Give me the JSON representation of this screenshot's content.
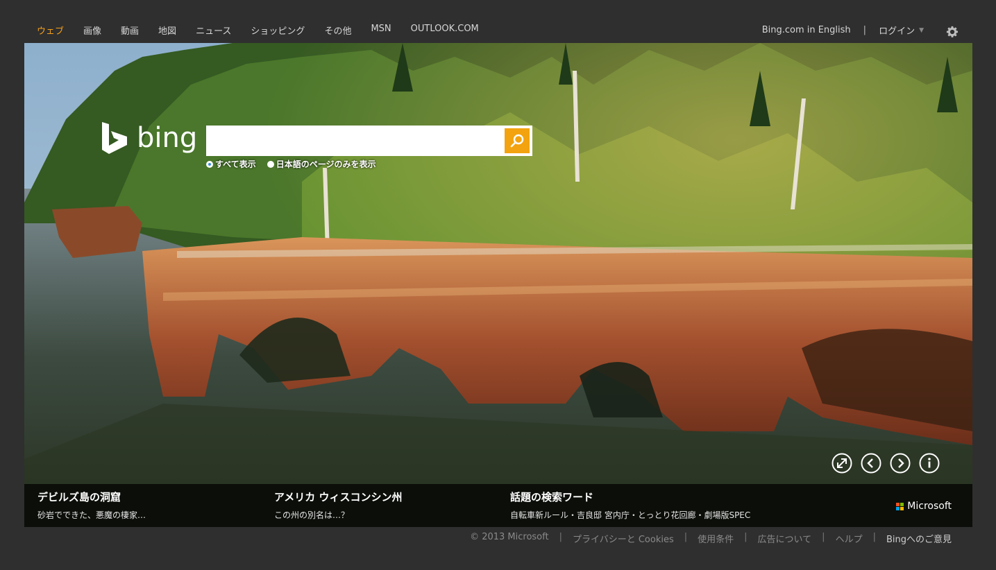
{
  "nav": {
    "items": [
      {
        "label": "ウェブ",
        "active": true
      },
      {
        "label": "画像"
      },
      {
        "label": "動画"
      },
      {
        "label": "地図"
      },
      {
        "label": "ニュース"
      },
      {
        "label": "ショッピング"
      },
      {
        "label": "その他"
      },
      {
        "label": "MSN"
      },
      {
        "label": "OUTLOOK.COM"
      }
    ],
    "english": "Bing.com in English",
    "separator": "|",
    "login": "ログイン",
    "settings_icon": "gear-icon"
  },
  "search": {
    "logo": "bing",
    "value": "",
    "placeholder": "",
    "radio_all": "すべて表示",
    "radio_japanese": "日本語のページのみを表示",
    "button_icon": "search-icon"
  },
  "controls": [
    "expand-icon",
    "prev-icon",
    "next-icon",
    "info-icon"
  ],
  "caption": {
    "items": [
      {
        "title": "デビルズ島の洞窟",
        "sub": "砂岩でできた、悪魔の棲家…"
      },
      {
        "title": "アメリカ ウィスコンシン州",
        "sub": "この州の別名は…？"
      },
      {
        "title": "話題の検索ワード",
        "sub": "自転車新ルール・吉良邸 宮内庁・とっとり花回廊・劇場版SPEC"
      }
    ],
    "microsoft": "Microsoft"
  },
  "footer": {
    "copyright": "© 2013 Microsoft",
    "privacy": "プライバシーと Cookies",
    "terms": "使用条件",
    "ads": "広告について",
    "help": "ヘルプ",
    "feedback": "Bingへのご意見",
    "separator": "|"
  },
  "colors": {
    "accent": "#f7a11a",
    "search_button": "#f3a30f",
    "background": "#2f2f2f"
  }
}
